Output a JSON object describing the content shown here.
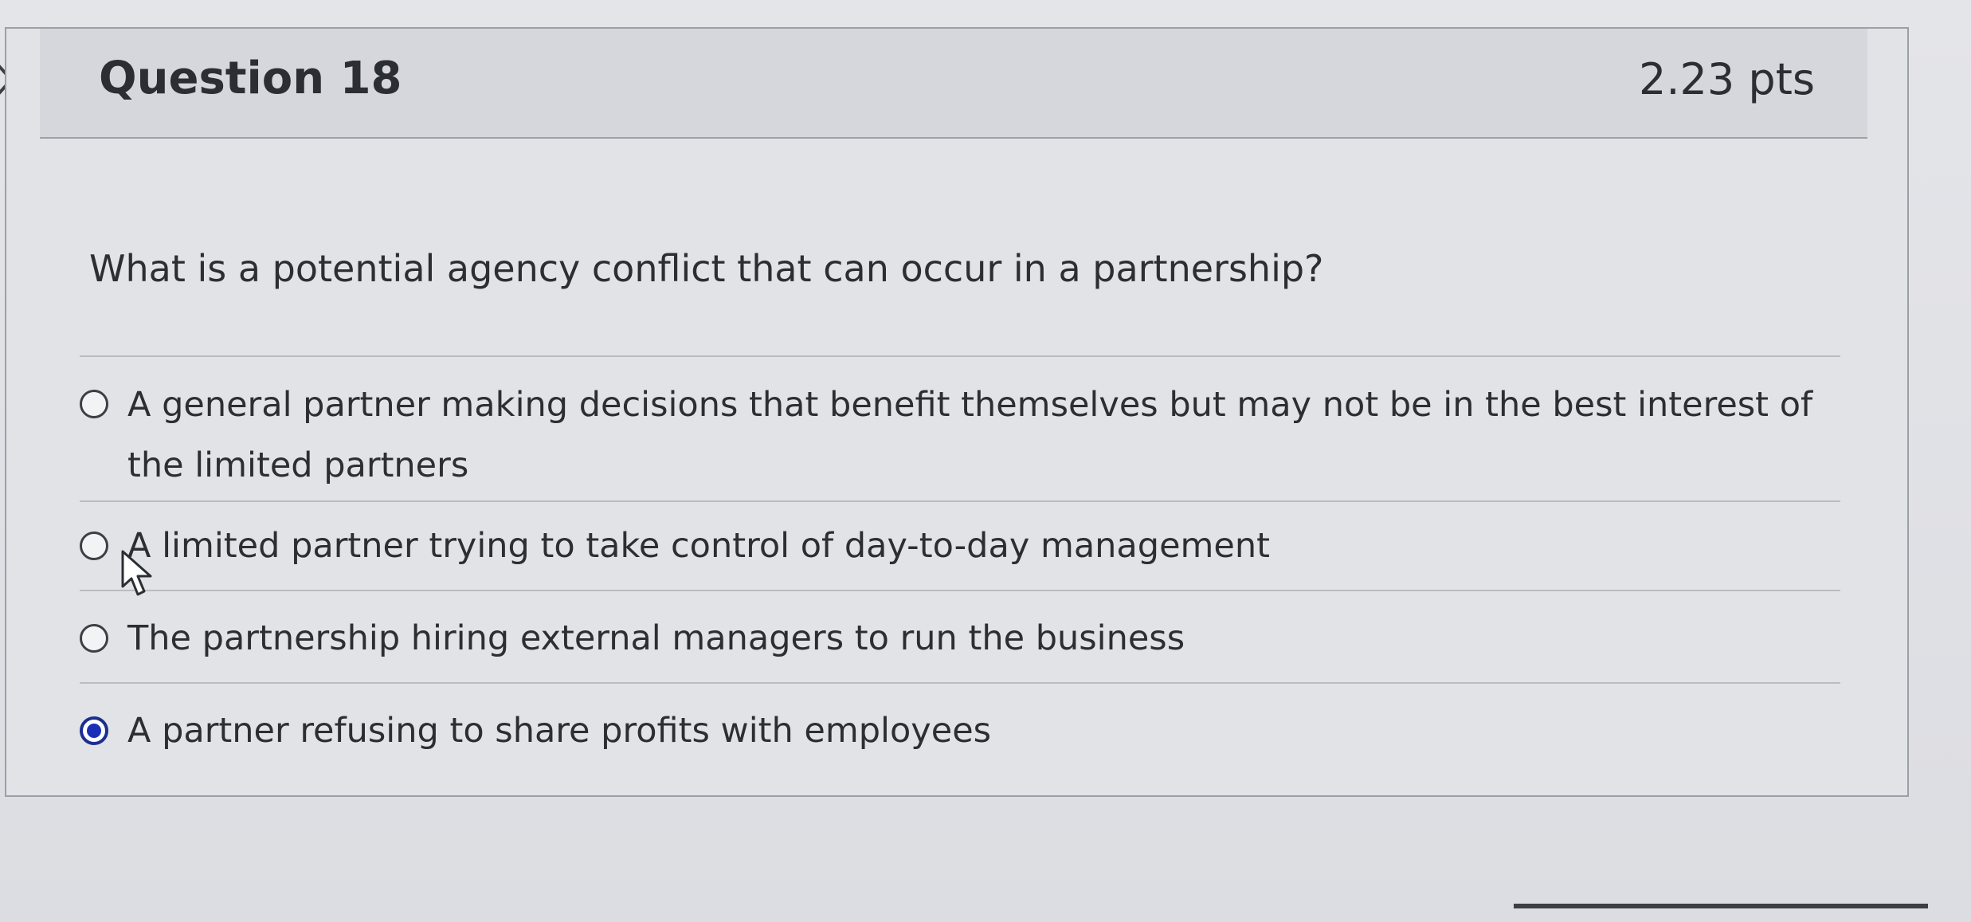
{
  "question": {
    "title": "Question 18",
    "points": "2.23 pts",
    "text": "What is a potential agency conflict that can occur in a partnership?"
  },
  "answers": [
    {
      "label": "A general partner making decisions that benefit themselves but may not be in the best interest of the limited partners",
      "selected": false
    },
    {
      "label": "A limited partner trying to take control of day-to-day management",
      "selected": false
    },
    {
      "label": "The partnership hiring external managers to run the business",
      "selected": false
    },
    {
      "label": "A partner refusing to share profits with employees",
      "selected": true
    }
  ],
  "icons": {
    "nav": "chevron-right-icon",
    "cursor": "mouse-pointer-icon"
  },
  "colors": {
    "selected_radio": "#1a2fb8",
    "header_background": "#d6d7dc"
  }
}
